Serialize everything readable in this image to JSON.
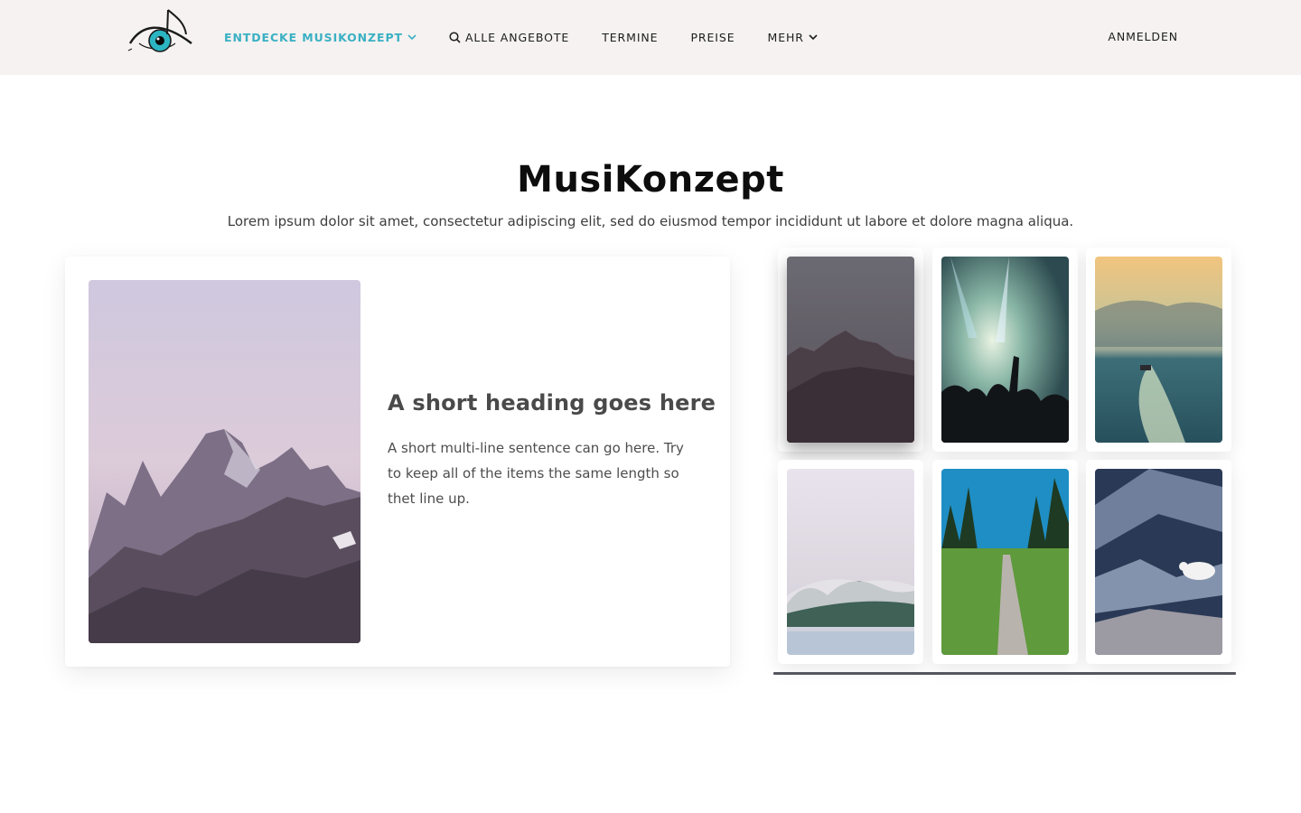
{
  "header": {
    "logo_icon": "eye-music-note-logo",
    "nav": [
      {
        "label": "Entdecke MusiKonzept",
        "icon": "chevron-down-icon",
        "active": true
      },
      {
        "label": "Alle Angebote",
        "icon": "search-icon"
      },
      {
        "label": "Termine"
      },
      {
        "label": "Preise"
      },
      {
        "label": "Mehr",
        "icon": "chevron-down-icon"
      }
    ],
    "login_label": "ANMELDEN"
  },
  "main": {
    "title": "MusiKonzept",
    "subtitle": "Lorem ipsum dolor sit amet, consectetur adipiscing elit, sed do eiusmod tempor incididunt ut labore et dolore magna aliqua.",
    "feature": {
      "heading": "A short heading goes here",
      "text": "A short multi-line sentence can go here. Try to keep all of the items the same length so thet line up."
    },
    "gallery": [
      {
        "name": "mountain-dusk"
      },
      {
        "name": "concert-crowd"
      },
      {
        "name": "boat-wake-sea"
      },
      {
        "name": "misty-lake"
      },
      {
        "name": "forest-path"
      },
      {
        "name": "mountain-goat"
      }
    ]
  },
  "colors": {
    "accent": "#3ab0c3",
    "header_bg": "#f5f2f1",
    "text_dark": "#0d0d0d",
    "gallery_bar": "#56565e"
  }
}
